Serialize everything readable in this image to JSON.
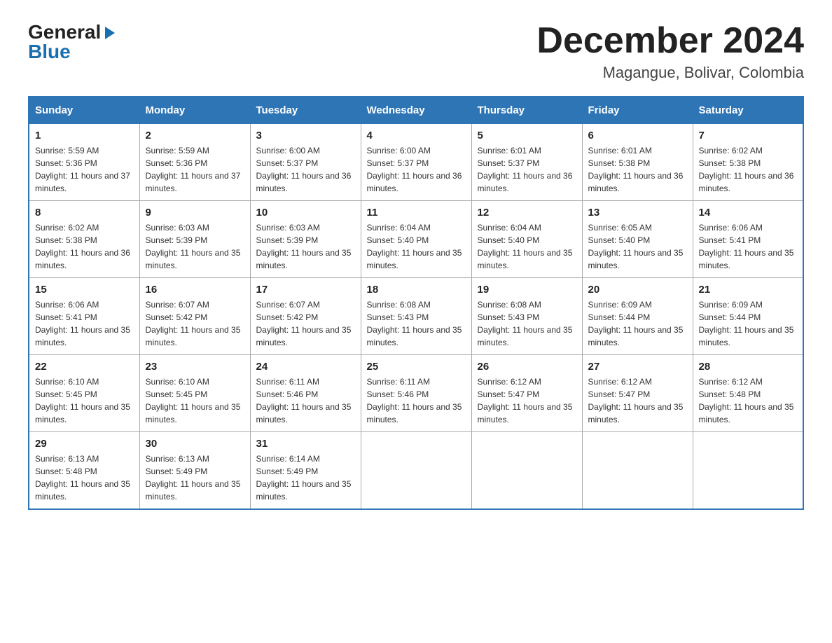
{
  "logo": {
    "general": "General",
    "blue": "Blue",
    "arrow": "▶"
  },
  "header": {
    "title": "December 2024",
    "subtitle": "Magangue, Bolivar, Colombia"
  },
  "weekdays": [
    "Sunday",
    "Monday",
    "Tuesday",
    "Wednesday",
    "Thursday",
    "Friday",
    "Saturday"
  ],
  "weeks": [
    [
      {
        "day": "1",
        "sunrise": "Sunrise: 5:59 AM",
        "sunset": "Sunset: 5:36 PM",
        "daylight": "Daylight: 11 hours and 37 minutes."
      },
      {
        "day": "2",
        "sunrise": "Sunrise: 5:59 AM",
        "sunset": "Sunset: 5:36 PM",
        "daylight": "Daylight: 11 hours and 37 minutes."
      },
      {
        "day": "3",
        "sunrise": "Sunrise: 6:00 AM",
        "sunset": "Sunset: 5:37 PM",
        "daylight": "Daylight: 11 hours and 36 minutes."
      },
      {
        "day": "4",
        "sunrise": "Sunrise: 6:00 AM",
        "sunset": "Sunset: 5:37 PM",
        "daylight": "Daylight: 11 hours and 36 minutes."
      },
      {
        "day": "5",
        "sunrise": "Sunrise: 6:01 AM",
        "sunset": "Sunset: 5:37 PM",
        "daylight": "Daylight: 11 hours and 36 minutes."
      },
      {
        "day": "6",
        "sunrise": "Sunrise: 6:01 AM",
        "sunset": "Sunset: 5:38 PM",
        "daylight": "Daylight: 11 hours and 36 minutes."
      },
      {
        "day": "7",
        "sunrise": "Sunrise: 6:02 AM",
        "sunset": "Sunset: 5:38 PM",
        "daylight": "Daylight: 11 hours and 36 minutes."
      }
    ],
    [
      {
        "day": "8",
        "sunrise": "Sunrise: 6:02 AM",
        "sunset": "Sunset: 5:38 PM",
        "daylight": "Daylight: 11 hours and 36 minutes."
      },
      {
        "day": "9",
        "sunrise": "Sunrise: 6:03 AM",
        "sunset": "Sunset: 5:39 PM",
        "daylight": "Daylight: 11 hours and 35 minutes."
      },
      {
        "day": "10",
        "sunrise": "Sunrise: 6:03 AM",
        "sunset": "Sunset: 5:39 PM",
        "daylight": "Daylight: 11 hours and 35 minutes."
      },
      {
        "day": "11",
        "sunrise": "Sunrise: 6:04 AM",
        "sunset": "Sunset: 5:40 PM",
        "daylight": "Daylight: 11 hours and 35 minutes."
      },
      {
        "day": "12",
        "sunrise": "Sunrise: 6:04 AM",
        "sunset": "Sunset: 5:40 PM",
        "daylight": "Daylight: 11 hours and 35 minutes."
      },
      {
        "day": "13",
        "sunrise": "Sunrise: 6:05 AM",
        "sunset": "Sunset: 5:40 PM",
        "daylight": "Daylight: 11 hours and 35 minutes."
      },
      {
        "day": "14",
        "sunrise": "Sunrise: 6:06 AM",
        "sunset": "Sunset: 5:41 PM",
        "daylight": "Daylight: 11 hours and 35 minutes."
      }
    ],
    [
      {
        "day": "15",
        "sunrise": "Sunrise: 6:06 AM",
        "sunset": "Sunset: 5:41 PM",
        "daylight": "Daylight: 11 hours and 35 minutes."
      },
      {
        "day": "16",
        "sunrise": "Sunrise: 6:07 AM",
        "sunset": "Sunset: 5:42 PM",
        "daylight": "Daylight: 11 hours and 35 minutes."
      },
      {
        "day": "17",
        "sunrise": "Sunrise: 6:07 AM",
        "sunset": "Sunset: 5:42 PM",
        "daylight": "Daylight: 11 hours and 35 minutes."
      },
      {
        "day": "18",
        "sunrise": "Sunrise: 6:08 AM",
        "sunset": "Sunset: 5:43 PM",
        "daylight": "Daylight: 11 hours and 35 minutes."
      },
      {
        "day": "19",
        "sunrise": "Sunrise: 6:08 AM",
        "sunset": "Sunset: 5:43 PM",
        "daylight": "Daylight: 11 hours and 35 minutes."
      },
      {
        "day": "20",
        "sunrise": "Sunrise: 6:09 AM",
        "sunset": "Sunset: 5:44 PM",
        "daylight": "Daylight: 11 hours and 35 minutes."
      },
      {
        "day": "21",
        "sunrise": "Sunrise: 6:09 AM",
        "sunset": "Sunset: 5:44 PM",
        "daylight": "Daylight: 11 hours and 35 minutes."
      }
    ],
    [
      {
        "day": "22",
        "sunrise": "Sunrise: 6:10 AM",
        "sunset": "Sunset: 5:45 PM",
        "daylight": "Daylight: 11 hours and 35 minutes."
      },
      {
        "day": "23",
        "sunrise": "Sunrise: 6:10 AM",
        "sunset": "Sunset: 5:45 PM",
        "daylight": "Daylight: 11 hours and 35 minutes."
      },
      {
        "day": "24",
        "sunrise": "Sunrise: 6:11 AM",
        "sunset": "Sunset: 5:46 PM",
        "daylight": "Daylight: 11 hours and 35 minutes."
      },
      {
        "day": "25",
        "sunrise": "Sunrise: 6:11 AM",
        "sunset": "Sunset: 5:46 PM",
        "daylight": "Daylight: 11 hours and 35 minutes."
      },
      {
        "day": "26",
        "sunrise": "Sunrise: 6:12 AM",
        "sunset": "Sunset: 5:47 PM",
        "daylight": "Daylight: 11 hours and 35 minutes."
      },
      {
        "day": "27",
        "sunrise": "Sunrise: 6:12 AM",
        "sunset": "Sunset: 5:47 PM",
        "daylight": "Daylight: 11 hours and 35 minutes."
      },
      {
        "day": "28",
        "sunrise": "Sunrise: 6:12 AM",
        "sunset": "Sunset: 5:48 PM",
        "daylight": "Daylight: 11 hours and 35 minutes."
      }
    ],
    [
      {
        "day": "29",
        "sunrise": "Sunrise: 6:13 AM",
        "sunset": "Sunset: 5:48 PM",
        "daylight": "Daylight: 11 hours and 35 minutes."
      },
      {
        "day": "30",
        "sunrise": "Sunrise: 6:13 AM",
        "sunset": "Sunset: 5:49 PM",
        "daylight": "Daylight: 11 hours and 35 minutes."
      },
      {
        "day": "31",
        "sunrise": "Sunrise: 6:14 AM",
        "sunset": "Sunset: 5:49 PM",
        "daylight": "Daylight: 11 hours and 35 minutes."
      },
      null,
      null,
      null,
      null
    ]
  ]
}
